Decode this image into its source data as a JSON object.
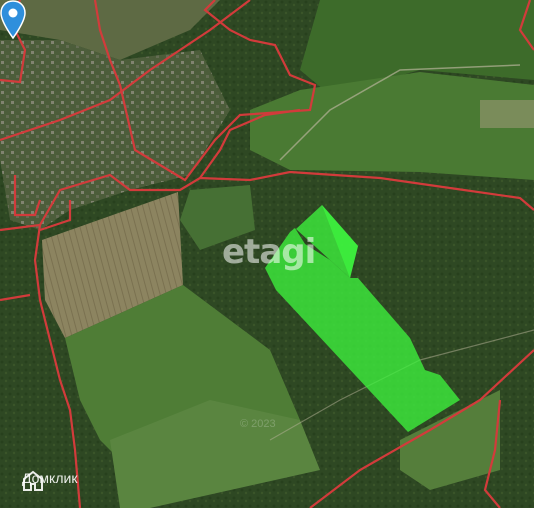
{
  "map": {
    "watermark": "etagi",
    "copyright": "© 2023",
    "brand": "Домклик",
    "colors": {
      "parcel_fill": "#3df23d",
      "boundary_line": "#d23b3b",
      "pin": "#2f8fdc"
    },
    "icons": [
      "map-pin-icon",
      "domclick-logo-icon"
    ]
  }
}
